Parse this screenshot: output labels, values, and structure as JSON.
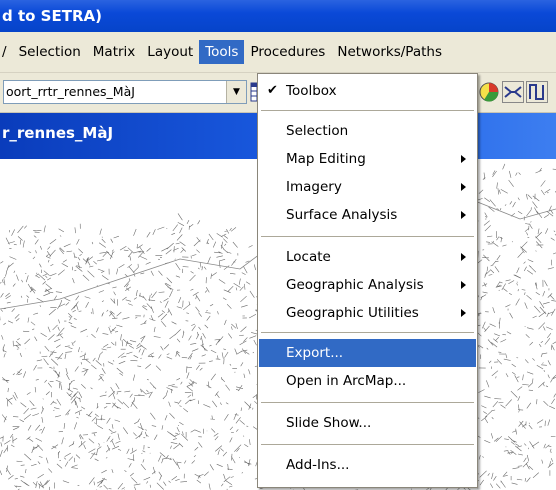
{
  "window": {
    "title": "d to SETRA)"
  },
  "menubar": {
    "items": [
      {
        "label": "/",
        "active": false
      },
      {
        "label": "Selection",
        "active": false
      },
      {
        "label": "Matrix",
        "active": false
      },
      {
        "label": "Layout",
        "active": false
      },
      {
        "label": "Tools",
        "active": true
      },
      {
        "label": "Procedures",
        "active": false
      },
      {
        "label": "Networks/Paths",
        "active": false
      }
    ]
  },
  "toolbar": {
    "layer_combo_value": "oort_rrtr_rennes_MàJ"
  },
  "document": {
    "title": "r_rennes_MàJ"
  },
  "tools_menu": {
    "items": [
      {
        "label": "Toolbox",
        "checked": true,
        "submenu": false
      },
      {
        "label": "Selection",
        "checked": false,
        "submenu": false
      },
      {
        "label": "Map Editing",
        "checked": false,
        "submenu": true
      },
      {
        "label": "Imagery",
        "checked": false,
        "submenu": true
      },
      {
        "label": "Surface Analysis",
        "checked": false,
        "submenu": true
      },
      {
        "label": "Locate",
        "checked": false,
        "submenu": true
      },
      {
        "label": "Geographic Analysis",
        "checked": false,
        "submenu": true
      },
      {
        "label": "Geographic Utilities",
        "checked": false,
        "submenu": true
      },
      {
        "label": "Export...",
        "checked": false,
        "submenu": false,
        "highlighted": true
      },
      {
        "label": "Open in ArcMap...",
        "checked": false,
        "submenu": false
      },
      {
        "label": "Slide Show...",
        "checked": false,
        "submenu": false
      },
      {
        "label": "Add-Ins...",
        "checked": false,
        "submenu": false
      }
    ]
  },
  "colors": {
    "title_bar": "#0a49d8",
    "menu_highlight": "#316ac5",
    "menu_bg": "#ece9d8"
  }
}
